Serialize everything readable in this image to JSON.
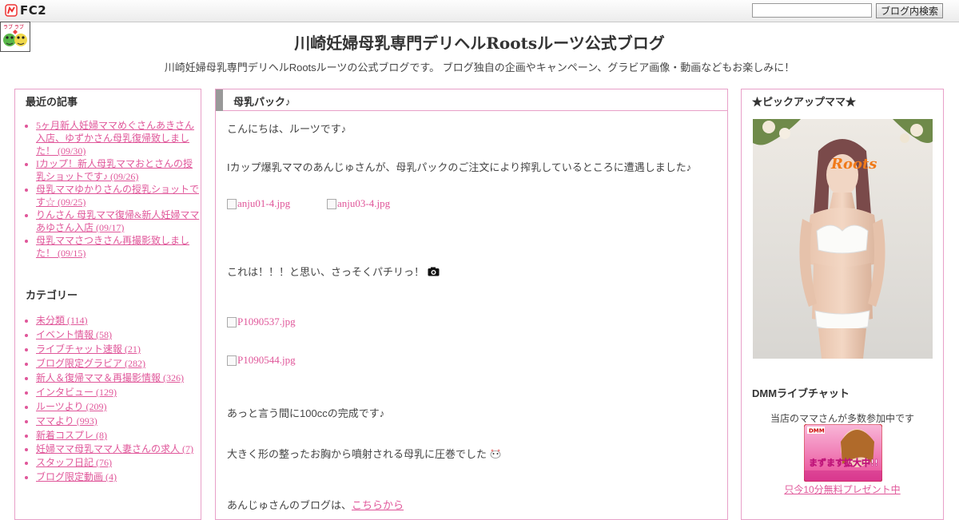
{
  "topbar": {
    "logo_text": "FC2",
    "search_placeholder": "",
    "search_button": "ブログ内検索"
  },
  "header": {
    "badge_text": "ラブ ラブ",
    "title": "川崎妊婦母乳専門デリヘルRootsルーツ公式ブログ",
    "description": "川崎妊婦母乳専門デリヘルRootsルーツの公式ブログです。 ブログ独自の企画やキャンペーン、グラビア画像・動画などもお楽しみに！"
  },
  "left": {
    "recent_title": "最近の記事",
    "recent": [
      "5ヶ月新人妊婦ママめぐさんあきさん入店、ゆずかさん母乳復帰致しました！ (09/30)",
      "Iカップ！新人母乳ママおとさんの授乳ショットです♪ (09/26)",
      "母乳ママゆかりさんの授乳ショットです☆ (09/25)",
      "りんさん 母乳ママ復帰&新人妊婦ママあゆさん入店 (09/17)",
      "母乳ママさつきさん再撮影致しました！ (09/15)"
    ],
    "category_title": "カテゴリー",
    "categories": [
      "未分類 (114)",
      "イベント情報 (58)",
      "ライブチャット速報 (21)",
      "ブログ限定グラビア (282)",
      "新人＆復帰ママ＆再撮影情報 (326)",
      "インタビュー (129)",
      "ルーツより (209)",
      "ママより (993)",
      "新着コスプレ (8)",
      "妊婦ママ母乳ママ人妻さんの求人 (7)",
      "スタッフ日記 (76)",
      "ブログ限定動画 (4)"
    ]
  },
  "main": {
    "title": "母乳パック♪",
    "p1": "こんにちは、ルーツです♪",
    "p2": "Iカップ爆乳ママのあんじゅさんが、母乳パックのご注文により搾乳しているところに遭遇しました♪",
    "img1": "anju01-4.jpg",
    "img2": "anju03-4.jpg",
    "p3": "これは！！！と思い、さっそくパチリっ！",
    "img3": "P1090537.jpg",
    "img4": "P1090544.jpg",
    "p4": "あっと言う間に100ccの完成です♪",
    "p5": "大きく形の整ったお胸から噴射される母乳に圧巻でした",
    "p6_prefix": "あんじゅさんのブログは、",
    "p6_link": "こちらから"
  },
  "right": {
    "pickup_title": "★ピックアップママ★",
    "photo_logo": "Roots",
    "dmm_title": "DMMライブチャット",
    "dmm_text": "当店のママさんが多数参加中です",
    "banner_top": "DMM",
    "banner_text": "まずます拡大中!!",
    "dmm_link": "只今10分無料プレゼント中"
  },
  "colors": {
    "link": "#e0579a",
    "border": "#e8a0c8",
    "heading_bar": "#999999"
  }
}
